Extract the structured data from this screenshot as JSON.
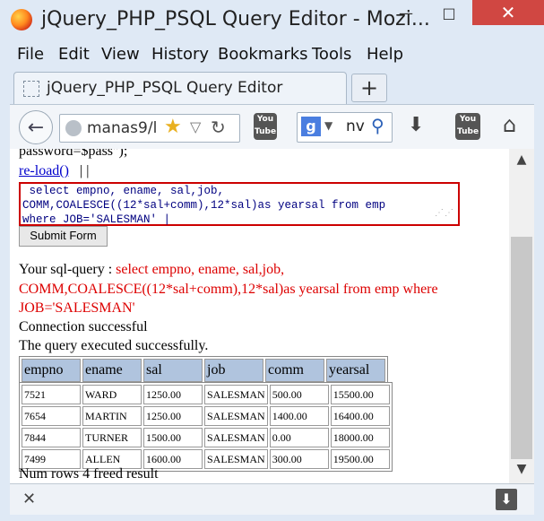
{
  "window": {
    "title": "jQuery_PHP_PSQL Query Editor - Mozi...",
    "min": "—",
    "max": "□",
    "close": "✕"
  },
  "menu": [
    "File",
    "Edit",
    "View",
    "History",
    "Bookmarks",
    "Tools",
    "Help"
  ],
  "tab": {
    "label": "jQuery_PHP_PSQL Query Editor",
    "new_tab": "+"
  },
  "nav": {
    "url": "manas9/l",
    "search": "nv",
    "search_engine": "g",
    "yt": "You Tube"
  },
  "page": {
    "cut_text": "password=$pass\");",
    "reload_link": "re-load()",
    "separator": "| |",
    "editor_lines": [
      " select empno, ename, sal,job,",
      "COMM,COALESCE((12*sal+comm),12*sal)as yearsal from emp",
      "where JOB='SALESMAN' |"
    ],
    "submit_label": "Submit Form",
    "query_label": "Your sql-query : ",
    "query_lines": [
      "select empno, ename, sal,job,",
      "COMM,COALESCE((12*sal+comm),12*sal)as yearsal from emp where",
      "JOB='SALESMAN'"
    ],
    "connection": "Connection successful",
    "executed": "The query executed successfully.",
    "headers": [
      "empno",
      "ename",
      "sal",
      "job",
      "comm",
      "yearsal"
    ],
    "rows": [
      [
        "7521",
        "WARD",
        "1250.00",
        "SALESMAN",
        "500.00",
        "15500.00"
      ],
      [
        "7654",
        "MARTIN",
        "1250.00",
        "SALESMAN",
        "1400.00",
        "16400.00"
      ],
      [
        "7844",
        "TURNER",
        "1500.00",
        "SALESMAN",
        "0.00",
        "18000.00"
      ],
      [
        "7499",
        "ALLEN",
        "1600.00",
        "SALESMAN",
        "300.00",
        "19500.00"
      ]
    ],
    "footer": "Num rows 4 freed result"
  }
}
